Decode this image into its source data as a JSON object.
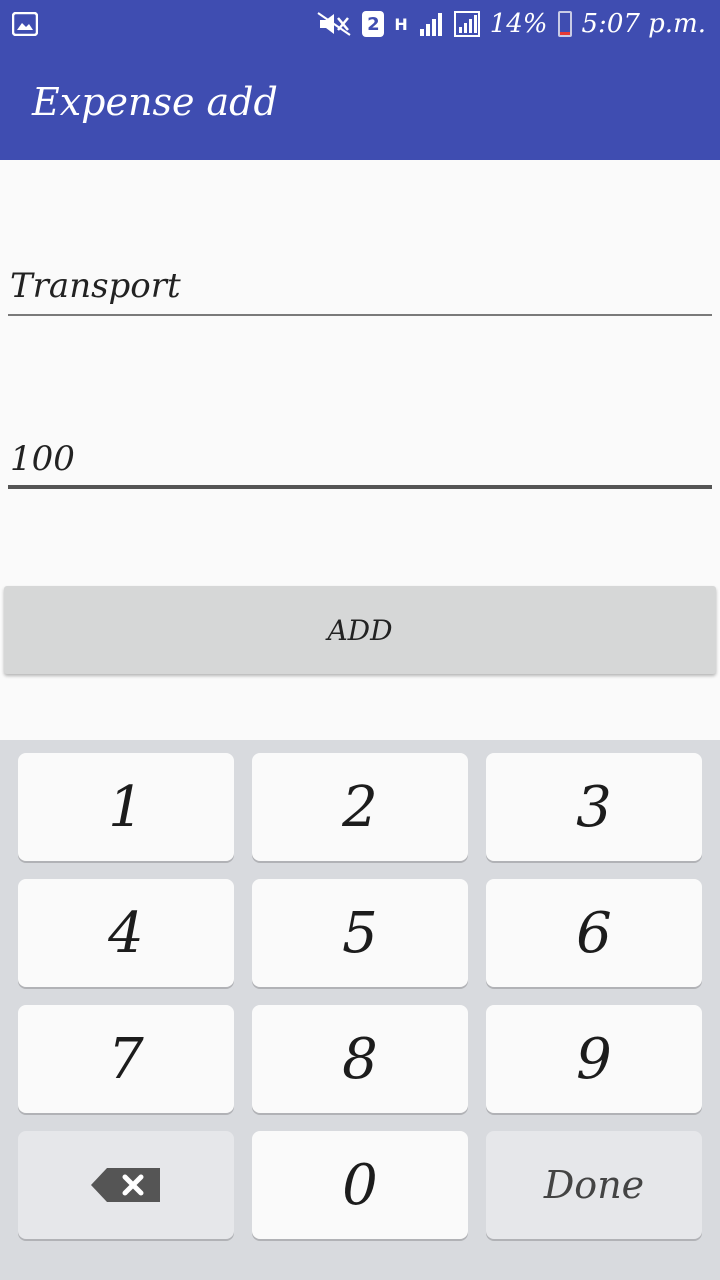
{
  "status_bar": {
    "sim_slot": "2",
    "network_type": "H",
    "battery_percent": "14%",
    "battery_level": 0.14,
    "time": "5:07 p.m.",
    "icons": [
      "gallery-notification-icon",
      "mute-icon",
      "sim-icon",
      "signal-icon",
      "battery-icon"
    ]
  },
  "app_bar": {
    "title": "Expense add"
  },
  "form": {
    "category_value": "Transport",
    "amount_value": "100",
    "add_button_label": "ADD"
  },
  "keyboard": {
    "keys": [
      "1",
      "2",
      "3",
      "4",
      "5",
      "6",
      "7",
      "8",
      "9",
      "0"
    ],
    "done_label": "Done",
    "backspace_icon": "backspace-icon"
  },
  "colors": {
    "primary": "#3f4db1",
    "background": "#fafafa",
    "button": "#d6d7d7",
    "keyboard": "#d8dade"
  }
}
